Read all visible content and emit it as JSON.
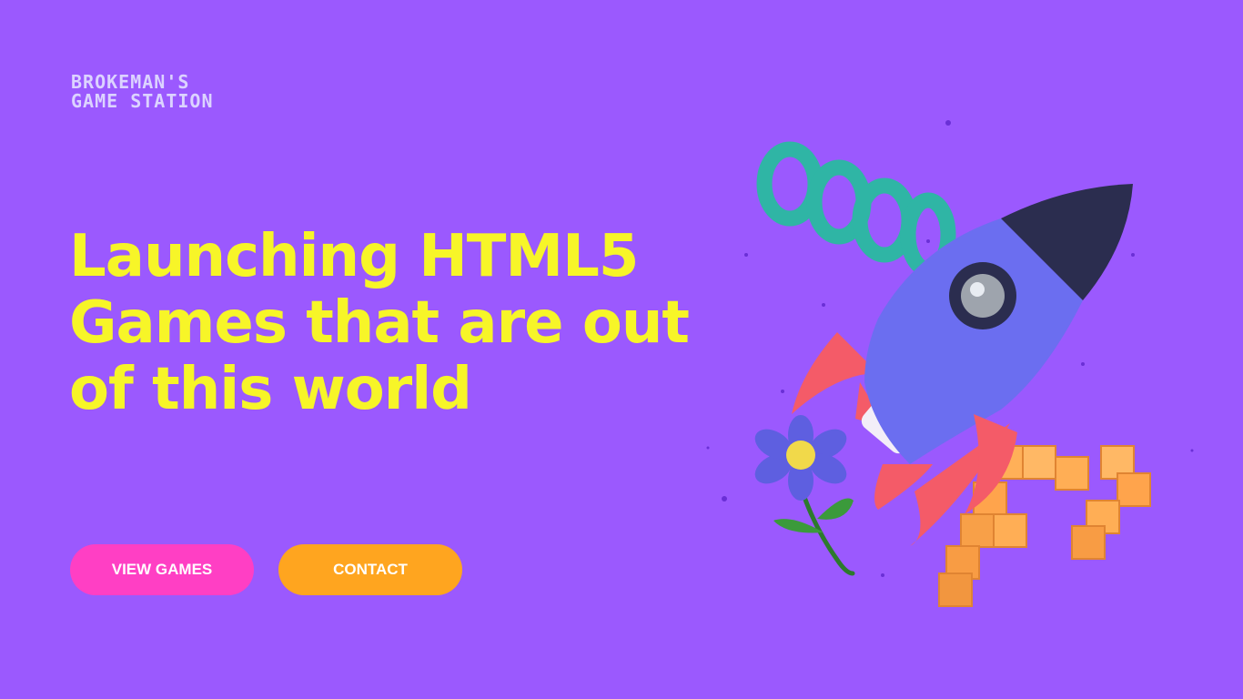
{
  "brand": {
    "line1": "BROKEMAN'S",
    "line2": "GAME STATION"
  },
  "hero": {
    "headline_lines": [
      "Launching HTML5",
      "Games that are out",
      "of this world"
    ]
  },
  "buttons": {
    "view_games": "VIEW GAMES",
    "contact": "CONTACT"
  },
  "colors": {
    "background": "#9b59fe",
    "headline": "#f7f528",
    "logo": "#dcd3ff",
    "view_games_button": "#ff3fc4",
    "contact_button": "#ffa51f"
  },
  "illustration": {
    "icons": [
      "rocket-icon",
      "spring-coil-icon",
      "flower-icon",
      "blocks-icon"
    ]
  }
}
